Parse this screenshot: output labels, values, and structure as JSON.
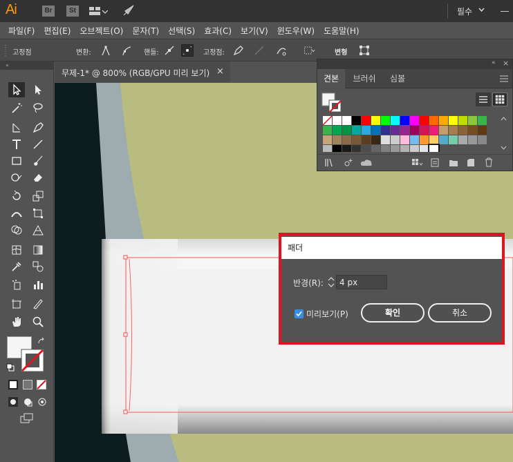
{
  "app": {
    "logo": "Ai",
    "badges": [
      "Br",
      "St"
    ],
    "workspace": "필수",
    "icons": [
      "layout-icon",
      "rocket-icon",
      "chevron-down-icon",
      "minimize-icon"
    ]
  },
  "menu": [
    "파일(F)",
    "편집(E)",
    "오브젝트(O)",
    "문자(T)",
    "선택(S)",
    "효과(C)",
    "보기(V)",
    "윈도우(W)",
    "도움말(H)"
  ],
  "control_bar": {
    "fixed_point": "고정점",
    "transform": "변환:",
    "handle": "핸들:",
    "anchor": "고정점:",
    "shape": "변형"
  },
  "toolbar": {
    "collapse": "«"
  },
  "document": {
    "tab_label": "무제-1* @ 800% (RGB/GPU 미리 보기)",
    "close": "×"
  },
  "swatches_panel": {
    "collapse": "«",
    "close": "×",
    "tabs": [
      "견본",
      "브러쉬",
      "심볼"
    ],
    "active_tab": 0
  },
  "dialog": {
    "title": "패더",
    "radius_label": "반경(R):",
    "radius_value": "4 px",
    "preview_label": "미리보기(P)",
    "preview_checked": true,
    "ok_label": "확인",
    "cancel_label": "취소"
  },
  "colors": {
    "accent_orange": "#ff9a00",
    "highlight_red": "#e0141e",
    "checkbox_blue": "#3b8de0",
    "canvas_olive": "#b9bc80"
  }
}
